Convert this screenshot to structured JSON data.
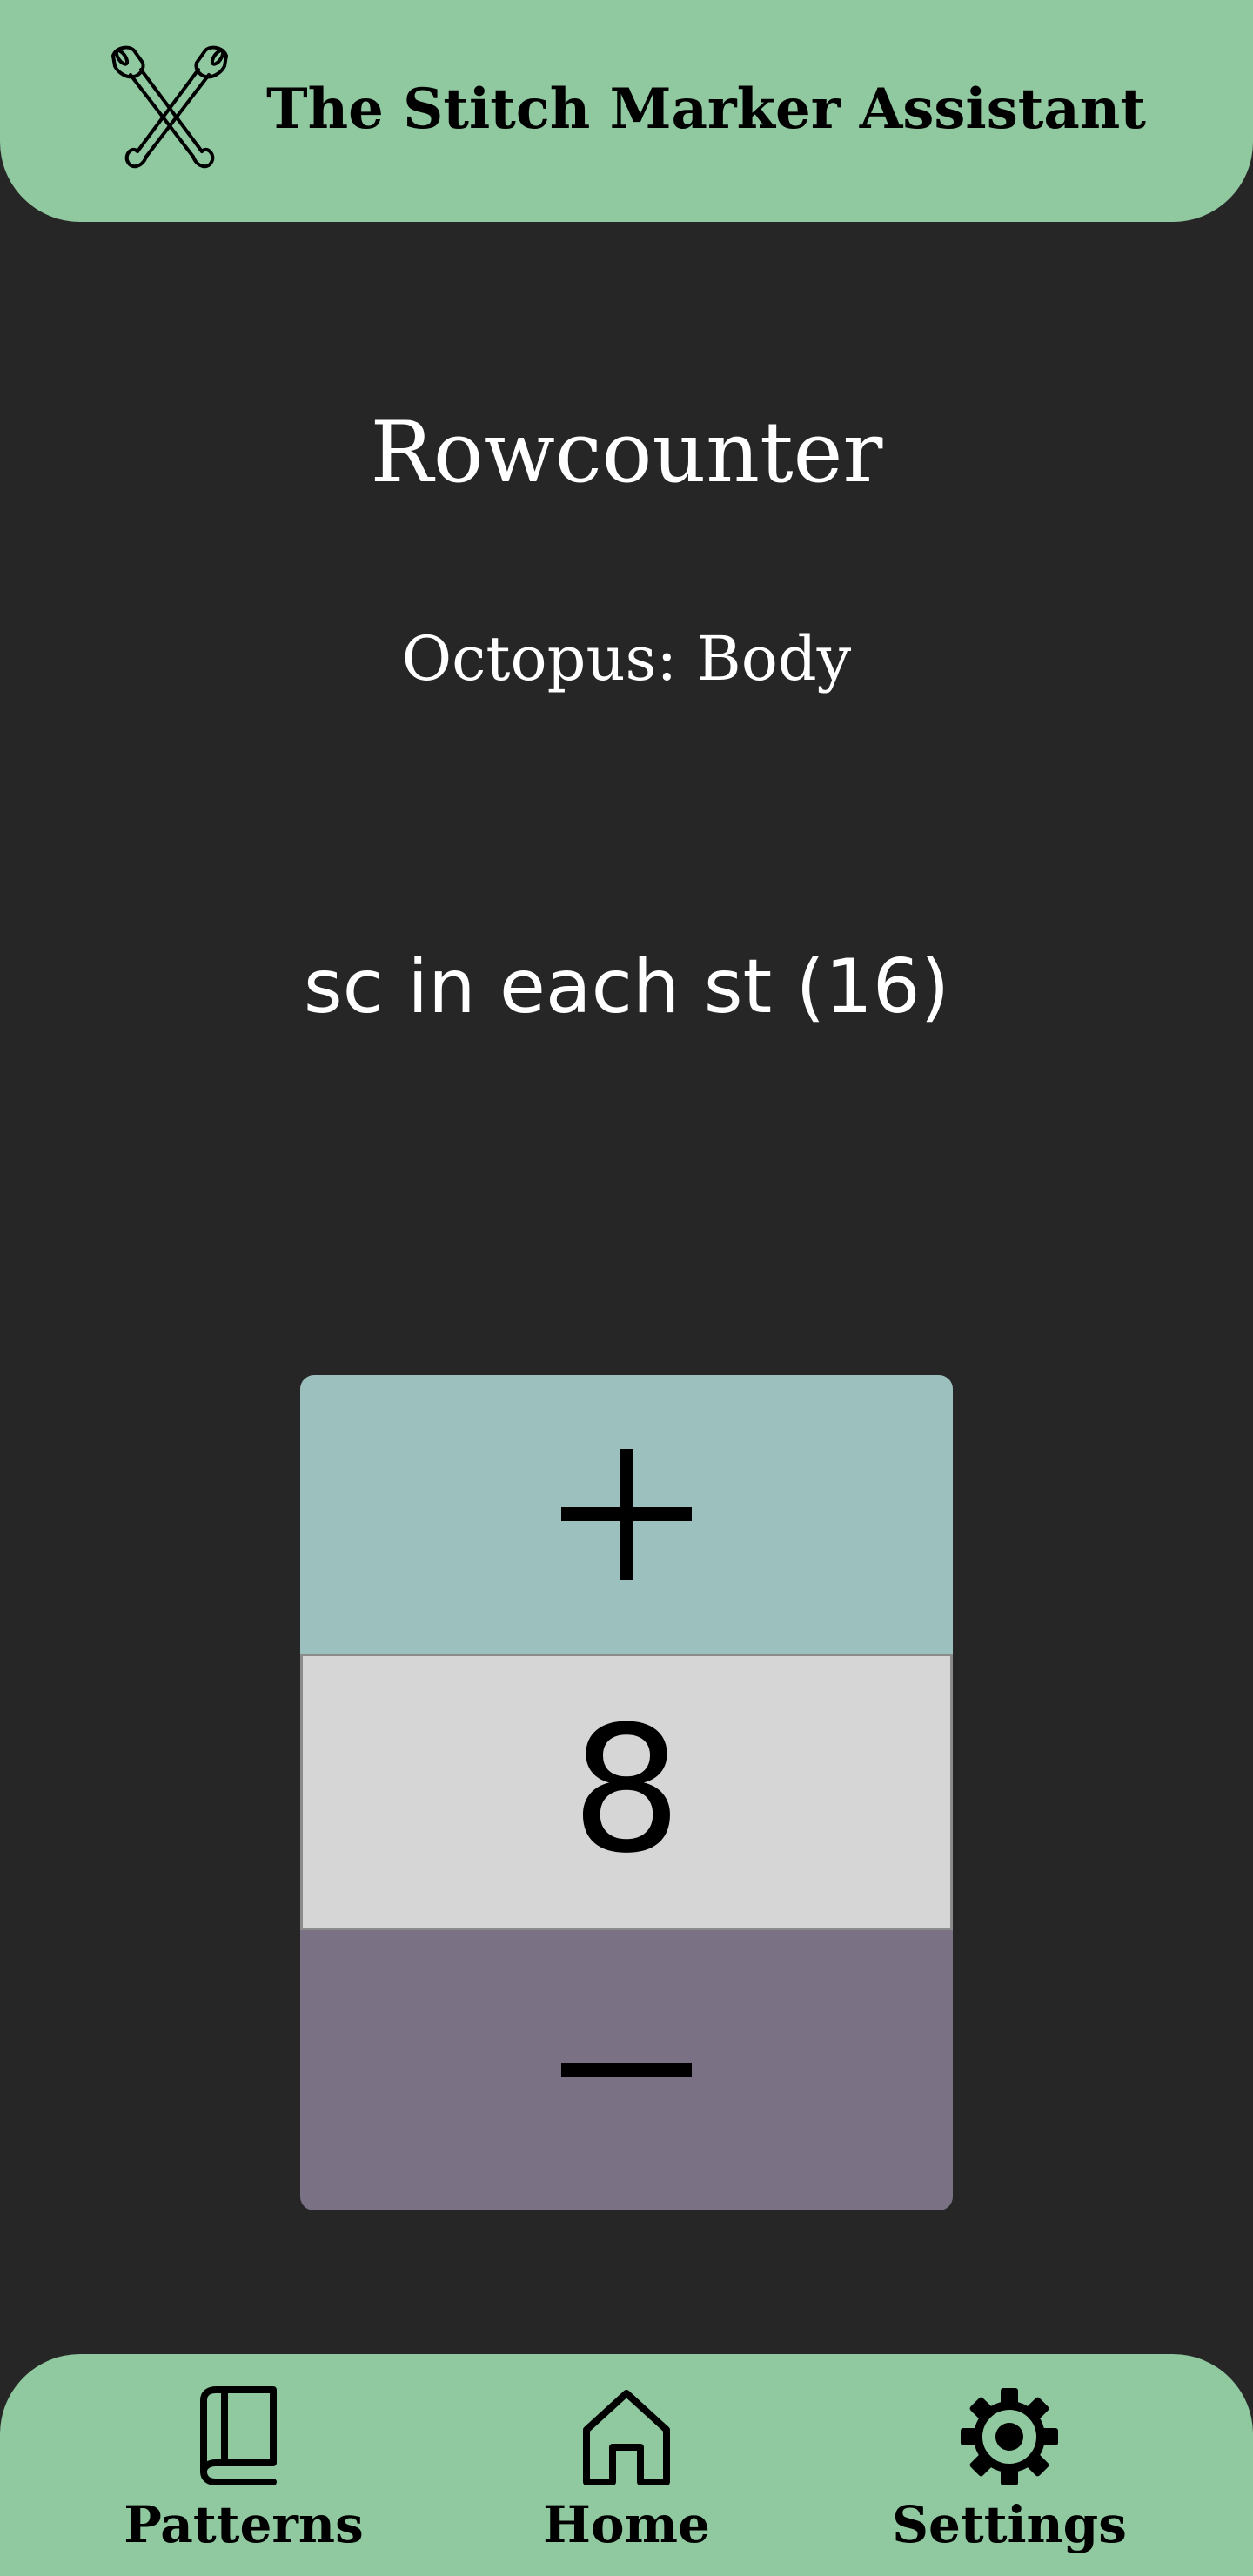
{
  "header": {
    "app_title": "The Stitch Marker Assistant",
    "logo_icon": "crossed-stitch-markers-icon"
  },
  "main": {
    "page_title": "Rowcounter",
    "pattern_section": "Octopus: Body",
    "instruction": "sc in each st (16)"
  },
  "counter": {
    "value": "8",
    "increment_icon": "plus-icon",
    "decrement_icon": "minus-icon"
  },
  "bottom_nav": {
    "items": [
      {
        "label": "Patterns",
        "icon": "book-icon"
      },
      {
        "label": "Home",
        "icon": "home-icon"
      },
      {
        "label": "Settings",
        "icon": "gear-icon"
      }
    ]
  },
  "colors": {
    "background": "#262626",
    "header_green": "#90c8a0",
    "increment_teal": "#9cc0be",
    "count_gray": "#d6d6d6",
    "decrement_purple": "#7a7185"
  }
}
